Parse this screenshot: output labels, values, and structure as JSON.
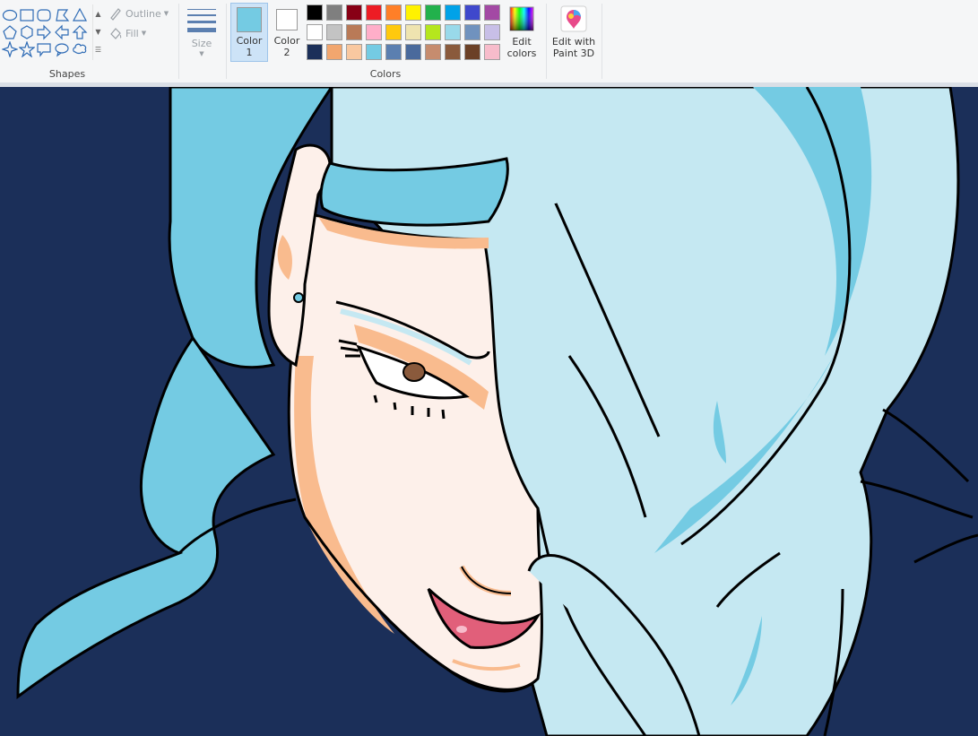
{
  "ribbon": {
    "shapes_group_label": "Shapes",
    "colors_group_label": "Colors",
    "outline_label": "Outline",
    "fill_label": "Fill",
    "size_label": "Size",
    "color1_label_line1": "Color",
    "color1_label_line2": "1",
    "color2_label_line1": "Color",
    "color2_label_line2": "2",
    "edit_colors_line1": "Edit",
    "edit_colors_line2": "colors",
    "paint3d_line1": "Edit with",
    "paint3d_line2": "Paint 3D",
    "shapes": [
      "oval-icon",
      "rectangle-icon",
      "rounded-rectangle-icon",
      "polygon-icon",
      "triangle-icon",
      "pentagon-icon",
      "hexagon-icon",
      "right-arrow-icon",
      "left-arrow-icon",
      "up-arrow-icon",
      "four-point-star-icon",
      "five-point-star-icon",
      "callout-rect-icon",
      "callout-oval-icon",
      "cloud-callout-icon"
    ]
  },
  "colors": {
    "color1": "#74cbe3",
    "color2": "#ffffff",
    "palette_row1": [
      "#000000",
      "#7f7f7f",
      "#880015",
      "#ed1c24",
      "#ff7f27",
      "#fff200",
      "#22b14c",
      "#00a2e8",
      "#3f48cc",
      "#a349a4"
    ],
    "palette_row2": [
      "#ffffff",
      "#c3c3c3",
      "#b97a57",
      "#ffaec9",
      "#ffc90e",
      "#efe4b0",
      "#b5e61d",
      "#99d9ea",
      "#7092be",
      "#c8bfe7"
    ],
    "palette_row3": [
      "#1b2f59",
      "#f2a66e",
      "#f9c8a0",
      "#74cbe3",
      "#5b7fb0",
      "#4a6a9c",
      "#c68c6e",
      "#8a5a3c",
      "#6b4026",
      "#f7bccb"
    ]
  },
  "canvas_colors": {
    "background": "#1b2f59",
    "hair_dark": "#74cbe3",
    "hair_light": "#c5e8f2",
    "skin": "#fdf0ea",
    "skin_shadow": "#f9bb8e",
    "lips": "#e15f7a",
    "eye_brown": "#8a5a3c",
    "outline": "#000000"
  }
}
